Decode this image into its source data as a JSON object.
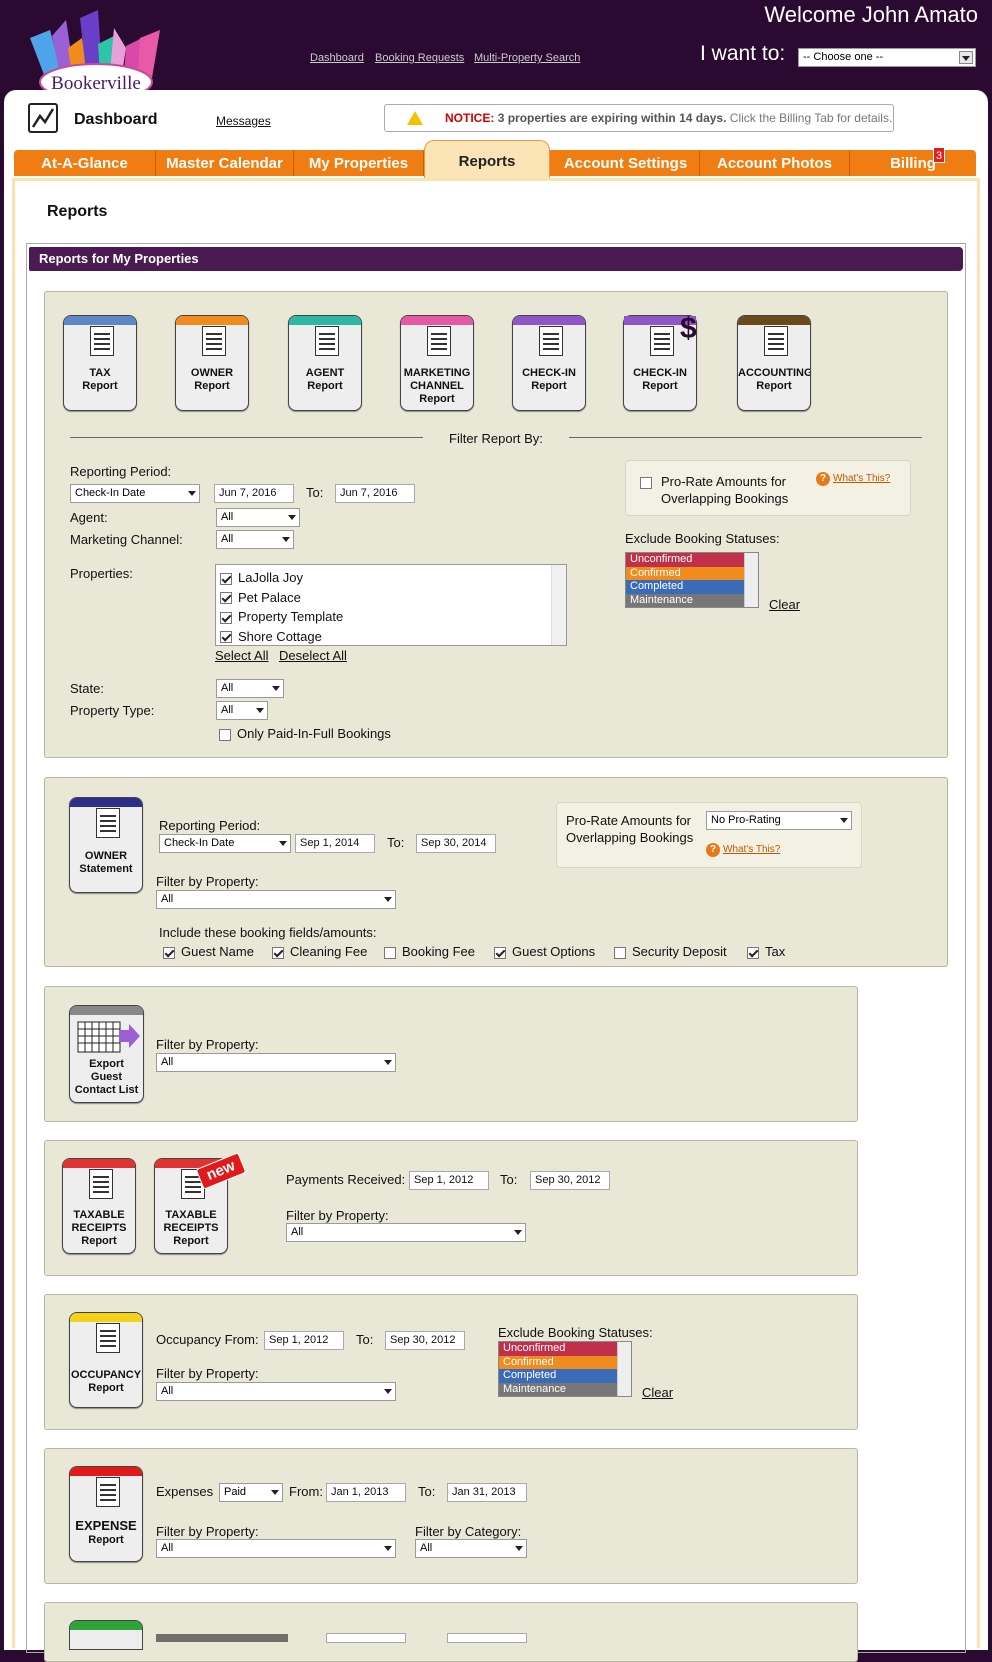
{
  "header": {
    "welcome": "Welcome John Amato",
    "logo_text": "Bookerville",
    "i_want_to_label": "I want to:",
    "i_want_to_value": "-- Choose one --",
    "top_links": [
      "Dashboard",
      "Booking Requests",
      "Multi-Property Search"
    ]
  },
  "dashboard": {
    "title": "Dashboard",
    "messages_link": "Messages",
    "notice_label": "NOTICE:",
    "notice_bold": "3 properties are expiring within 14 days.",
    "notice_rest": "Click the Billing Tab for details."
  },
  "tabs": [
    "At-A-Glance",
    "Master Calendar",
    "My Properties",
    "Reports",
    "Account Settings",
    "Account Photos",
    "Billing"
  ],
  "billing_badge": "3",
  "page": {
    "title": "Reports",
    "section_bar": "Reports for My Properties"
  },
  "report_icons": [
    {
      "line1": "TAX",
      "line2": "Report",
      "line3": "",
      "color": "#5d87c7"
    },
    {
      "line1": "OWNER",
      "line2": "Report",
      "line3": "",
      "color": "#f08b1e"
    },
    {
      "line1": "AGENT",
      "line2": "Report",
      "line3": "",
      "color": "#2eb8a4"
    },
    {
      "line1": "MARKETING",
      "line2": "CHANNEL",
      "line3": "Report",
      "color": "#e35aa3"
    },
    {
      "line1": "CHECK-IN",
      "line2": "Report",
      "line3": "",
      "color": "#8e56c6"
    },
    {
      "line1": "CHECK-IN",
      "line2": "Report",
      "line3": "",
      "color": "#8e56c6"
    },
    {
      "line1": "ACCOUNTING",
      "line2": "Report",
      "line3": "",
      "color": "#6b4a1a"
    }
  ],
  "filter": {
    "heading": "Filter Report By:",
    "reporting_period_label": "Reporting Period:",
    "reporting_period_value": "Check-In Date",
    "from": "Jun 7, 2016",
    "to_label": "To:",
    "to": "Jun 7, 2016",
    "agent_label": "Agent:",
    "agent_value": "All",
    "channel_label": "Marketing Channel:",
    "channel_value": "All",
    "properties_label": "Properties:",
    "properties": [
      "LaJolla Joy",
      "Pet Palace",
      "Property Template",
      "Shore Cottage"
    ],
    "select_all": "Select All",
    "deselect_all": "Deselect All",
    "state_label": "State:",
    "state_value": "All",
    "property_type_label": "Property Type:",
    "property_type_value": "All",
    "paid_in_full": "Only Paid-In-Full Bookings",
    "prorate_line1": "Pro-Rate Amounts for",
    "prorate_line2": "Overlapping Bookings",
    "whats_this": "What's This?",
    "exclude_label": "Exclude Booking Statuses:",
    "statuses": [
      {
        "name": "Unconfirmed",
        "color": "#c0304a"
      },
      {
        "name": "Confirmed",
        "color": "#f08b1e"
      },
      {
        "name": "Completed",
        "color": "#3a6bb8"
      },
      {
        "name": "Maintenance",
        "color": "#777777"
      }
    ],
    "clear": "Clear"
  },
  "owner_statement": {
    "icon_line1": "OWNER",
    "icon_line2": "Statement",
    "icon_color": "#2c2e8a",
    "reporting_period_label": "Reporting Period:",
    "reporting_period_value": "Check-In Date",
    "from": "Sep 1, 2014",
    "to_label": "To:",
    "to": "Sep 30, 2014",
    "filter_label": "Filter by Property:",
    "filter_value": "All",
    "prorate_line1": "Pro-Rate Amounts for",
    "prorate_line2": "Overlapping Bookings",
    "prorate_value": "No Pro-Rating",
    "whats_this": "What's This?",
    "include_label": "Include these booking fields/amounts:",
    "fields": [
      {
        "label": "Guest Name",
        "checked": true
      },
      {
        "label": "Cleaning Fee",
        "checked": true
      },
      {
        "label": "Booking Fee",
        "checked": false
      },
      {
        "label": "Guest Options",
        "checked": true
      },
      {
        "label": "Security Deposit",
        "checked": false
      },
      {
        "label": "Tax",
        "checked": true
      }
    ]
  },
  "export_guest": {
    "icon_line1": "Export",
    "icon_line2": "Guest",
    "icon_line3": "Contact List",
    "filter_label": "Filter by Property:",
    "filter_value": "All"
  },
  "taxable": {
    "icon1_line1": "TAXABLE",
    "icon1_line2": "RECEIPTS",
    "icon1_line3": "Report",
    "icon2_line1": "TAXABLE",
    "icon2_line2": "RECEIPTS",
    "icon2_line3": "Report",
    "new_badge": "new",
    "color": "#e03232",
    "payments_label": "Payments Received:",
    "from": "Sep 1, 2012",
    "to_label": "To:",
    "to": "Sep 30, 2012",
    "filter_label": "Filter by Property:",
    "filter_value": "All"
  },
  "occupancy": {
    "icon_line1": "OCCUPANCY",
    "icon_line2": "Report",
    "color": "#f2d21a",
    "from_label": "Occupancy From:",
    "from": "Sep 1, 2012",
    "to_label": "To:",
    "to": "Sep 30, 2012",
    "filter_label": "Filter by Property:",
    "filter_value": "All",
    "exclude_label": "Exclude Booking Statuses:",
    "clear": "Clear"
  },
  "expense": {
    "icon_line1": "EXPENSE",
    "icon_line2": "Report",
    "color": "#e01a1a",
    "expenses_label": "Expenses",
    "expenses_value": "Paid",
    "from_label": "From:",
    "from": "Jan 1, 2013",
    "to_label": "To:",
    "to": "Jan 31, 2013",
    "filter_label": "Filter by Property:",
    "filter_value": "All",
    "category_label": "Filter by Category:",
    "category_value": "All"
  },
  "last_section": {
    "color": "#2ea33a"
  }
}
